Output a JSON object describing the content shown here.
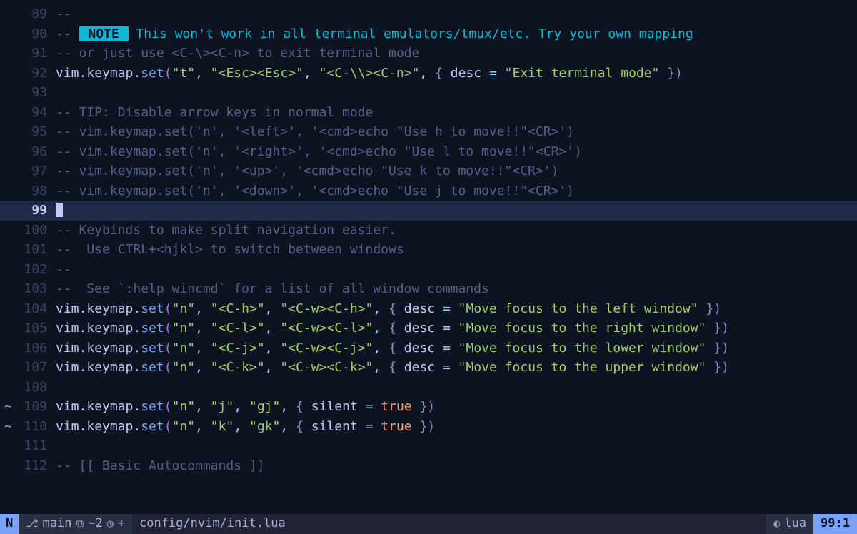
{
  "editor": {
    "filetype": "lua",
    "filepath": "config/nvim/init.lua",
    "cursor_line_index": 99,
    "lines": [
      {
        "num": 89,
        "sign": "",
        "tokens": [
          [
            "cmt",
            "--"
          ]
        ]
      },
      {
        "num": 90,
        "sign": "",
        "tokens": [
          [
            "cmt",
            "-- "
          ],
          [
            "note-bg",
            " NOTE "
          ],
          [
            "note-text",
            " This won't work in all terminal emulators/tmux/etc. Try your own mapping"
          ]
        ]
      },
      {
        "num": 91,
        "sign": "",
        "tokens": [
          [
            "cmt",
            "-- or just use <C-\\><C-n> to exit terminal mode"
          ]
        ]
      },
      {
        "num": 92,
        "sign": "",
        "tokens": [
          [
            "ident",
            "vim"
          ],
          [
            "punct",
            "."
          ],
          [
            "ident",
            "keymap"
          ],
          [
            "punct",
            "."
          ],
          [
            "func",
            "set"
          ],
          [
            "paren",
            "("
          ],
          [
            "str",
            "\"t\""
          ],
          [
            "punct",
            ", "
          ],
          [
            "str",
            "\"<Esc><Esc>\""
          ],
          [
            "punct",
            ", "
          ],
          [
            "str",
            "\"<C-\\\\><C-n>\""
          ],
          [
            "punct",
            ", "
          ],
          [
            "brace",
            "{ "
          ],
          [
            "ident",
            "desc"
          ],
          [
            "punct",
            " = "
          ],
          [
            "str",
            "\"Exit terminal mode\""
          ],
          [
            "brace",
            " }"
          ],
          [
            "paren",
            ")"
          ]
        ]
      },
      {
        "num": 93,
        "sign": "",
        "tokens": []
      },
      {
        "num": 94,
        "sign": "",
        "tokens": [
          [
            "cmt",
            "-- TIP: Disable arrow keys in normal mode"
          ]
        ]
      },
      {
        "num": 95,
        "sign": "",
        "tokens": [
          [
            "cmt",
            "-- vim.keymap.set('n', '<left>', '<cmd>echo \"Use h to move!!\"<CR>')"
          ]
        ]
      },
      {
        "num": 96,
        "sign": "",
        "tokens": [
          [
            "cmt",
            "-- vim.keymap.set('n', '<right>', '<cmd>echo \"Use l to move!!\"<CR>')"
          ]
        ]
      },
      {
        "num": 97,
        "sign": "",
        "tokens": [
          [
            "cmt",
            "-- vim.keymap.set('n', '<up>', '<cmd>echo \"Use k to move!!\"<CR>')"
          ]
        ]
      },
      {
        "num": 98,
        "sign": "",
        "tokens": [
          [
            "cmt",
            "-- vim.keymap.set('n', '<down>', '<cmd>echo \"Use j to move!!\"<CR>')"
          ]
        ]
      },
      {
        "num": 99,
        "sign": "",
        "cursor": true,
        "tokens": []
      },
      {
        "num": 100,
        "sign": "",
        "tokens": [
          [
            "cmt",
            "-- Keybinds to make split navigation easier."
          ]
        ]
      },
      {
        "num": 101,
        "sign": "",
        "tokens": [
          [
            "cmt",
            "--  Use CTRL+<hjkl> to switch between windows"
          ]
        ]
      },
      {
        "num": 102,
        "sign": "",
        "tokens": [
          [
            "cmt",
            "--"
          ]
        ]
      },
      {
        "num": 103,
        "sign": "",
        "tokens": [
          [
            "cmt",
            "--  See `:help wincmd` for a list of all window commands"
          ]
        ]
      },
      {
        "num": 104,
        "sign": "",
        "tokens": [
          [
            "ident",
            "vim"
          ],
          [
            "punct",
            "."
          ],
          [
            "ident",
            "keymap"
          ],
          [
            "punct",
            "."
          ],
          [
            "func",
            "set"
          ],
          [
            "paren",
            "("
          ],
          [
            "str",
            "\"n\""
          ],
          [
            "punct",
            ", "
          ],
          [
            "str",
            "\"<C-h>\""
          ],
          [
            "punct",
            ", "
          ],
          [
            "str",
            "\"<C-w><C-h>\""
          ],
          [
            "punct",
            ", "
          ],
          [
            "brace",
            "{ "
          ],
          [
            "ident",
            "desc"
          ],
          [
            "punct",
            " = "
          ],
          [
            "str",
            "\"Move focus to the left window\""
          ],
          [
            "brace",
            " }"
          ],
          [
            "paren",
            ")"
          ]
        ]
      },
      {
        "num": 105,
        "sign": "",
        "tokens": [
          [
            "ident",
            "vim"
          ],
          [
            "punct",
            "."
          ],
          [
            "ident",
            "keymap"
          ],
          [
            "punct",
            "."
          ],
          [
            "func",
            "set"
          ],
          [
            "paren",
            "("
          ],
          [
            "str",
            "\"n\""
          ],
          [
            "punct",
            ", "
          ],
          [
            "str",
            "\"<C-l>\""
          ],
          [
            "punct",
            ", "
          ],
          [
            "str",
            "\"<C-w><C-l>\""
          ],
          [
            "punct",
            ", "
          ],
          [
            "brace",
            "{ "
          ],
          [
            "ident",
            "desc"
          ],
          [
            "punct",
            " = "
          ],
          [
            "str",
            "\"Move focus to the right window\""
          ],
          [
            "brace",
            " }"
          ],
          [
            "paren",
            ")"
          ]
        ]
      },
      {
        "num": 106,
        "sign": "",
        "tokens": [
          [
            "ident",
            "vim"
          ],
          [
            "punct",
            "."
          ],
          [
            "ident",
            "keymap"
          ],
          [
            "punct",
            "."
          ],
          [
            "func",
            "set"
          ],
          [
            "paren",
            "("
          ],
          [
            "str",
            "\"n\""
          ],
          [
            "punct",
            ", "
          ],
          [
            "str",
            "\"<C-j>\""
          ],
          [
            "punct",
            ", "
          ],
          [
            "str",
            "\"<C-w><C-j>\""
          ],
          [
            "punct",
            ", "
          ],
          [
            "brace",
            "{ "
          ],
          [
            "ident",
            "desc"
          ],
          [
            "punct",
            " = "
          ],
          [
            "str",
            "\"Move focus to the lower window\""
          ],
          [
            "brace",
            " }"
          ],
          [
            "paren",
            ")"
          ]
        ]
      },
      {
        "num": 107,
        "sign": "",
        "tokens": [
          [
            "ident",
            "vim"
          ],
          [
            "punct",
            "."
          ],
          [
            "ident",
            "keymap"
          ],
          [
            "punct",
            "."
          ],
          [
            "func",
            "set"
          ],
          [
            "paren",
            "("
          ],
          [
            "str",
            "\"n\""
          ],
          [
            "punct",
            ", "
          ],
          [
            "str",
            "\"<C-k>\""
          ],
          [
            "punct",
            ", "
          ],
          [
            "str",
            "\"<C-w><C-k>\""
          ],
          [
            "punct",
            ", "
          ],
          [
            "brace",
            "{ "
          ],
          [
            "ident",
            "desc"
          ],
          [
            "punct",
            " = "
          ],
          [
            "str",
            "\"Move focus to the upper window\""
          ],
          [
            "brace",
            " }"
          ],
          [
            "paren",
            ")"
          ]
        ]
      },
      {
        "num": 108,
        "sign": "",
        "tokens": []
      },
      {
        "num": 109,
        "sign": "~",
        "tokens": [
          [
            "ident",
            "vim"
          ],
          [
            "punct",
            "."
          ],
          [
            "ident",
            "keymap"
          ],
          [
            "punct",
            "."
          ],
          [
            "func",
            "set"
          ],
          [
            "paren",
            "("
          ],
          [
            "str",
            "\"n\""
          ],
          [
            "punct",
            ", "
          ],
          [
            "str",
            "\"j\""
          ],
          [
            "punct",
            ", "
          ],
          [
            "str",
            "\"gj\""
          ],
          [
            "punct",
            ", "
          ],
          [
            "brace",
            "{ "
          ],
          [
            "ident",
            "silent"
          ],
          [
            "punct",
            " = "
          ],
          [
            "bool",
            "true"
          ],
          [
            "brace",
            " }"
          ],
          [
            "paren",
            ")"
          ]
        ]
      },
      {
        "num": 110,
        "sign": "~",
        "tokens": [
          [
            "ident",
            "vim"
          ],
          [
            "punct",
            "."
          ],
          [
            "ident",
            "keymap"
          ],
          [
            "punct",
            "."
          ],
          [
            "func",
            "set"
          ],
          [
            "paren",
            "("
          ],
          [
            "str",
            "\"n\""
          ],
          [
            "punct",
            ", "
          ],
          [
            "str",
            "\"k\""
          ],
          [
            "punct",
            ", "
          ],
          [
            "str",
            "\"gk\""
          ],
          [
            "punct",
            ", "
          ],
          [
            "brace",
            "{ "
          ],
          [
            "ident",
            "silent"
          ],
          [
            "punct",
            " = "
          ],
          [
            "bool",
            "true"
          ],
          [
            "brace",
            " }"
          ],
          [
            "paren",
            ")"
          ]
        ]
      },
      {
        "num": 111,
        "sign": "",
        "tokens": []
      },
      {
        "num": 112,
        "sign": "",
        "tokens": [
          [
            "cmt",
            "-- [[ Basic Autocommands ]]"
          ]
        ]
      }
    ]
  },
  "statusline": {
    "mode": "N",
    "git_branch": "main",
    "git_diff": "~2",
    "git_extra": "+",
    "file": "config/nvim/init.lua",
    "filetype": "lua",
    "position": "99:1"
  }
}
